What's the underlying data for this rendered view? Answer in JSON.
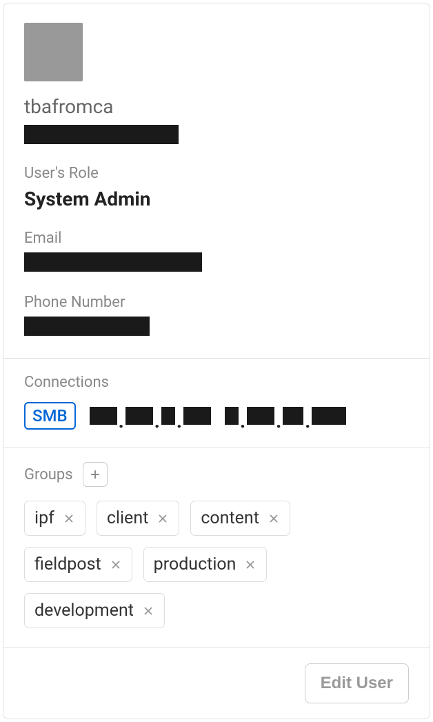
{
  "user": {
    "username": "tbafromca",
    "role_label": "User's Role",
    "role_value": "System Admin",
    "email_label": "Email",
    "phone_label": "Phone Number"
  },
  "connections": {
    "label": "Connections",
    "protocol": "SMB"
  },
  "groups": {
    "label": "Groups",
    "items": [
      {
        "name": "ipf"
      },
      {
        "name": "client"
      },
      {
        "name": "content"
      },
      {
        "name": "fieldpost"
      },
      {
        "name": "production"
      },
      {
        "name": "development"
      }
    ]
  },
  "actions": {
    "edit": "Edit User"
  }
}
